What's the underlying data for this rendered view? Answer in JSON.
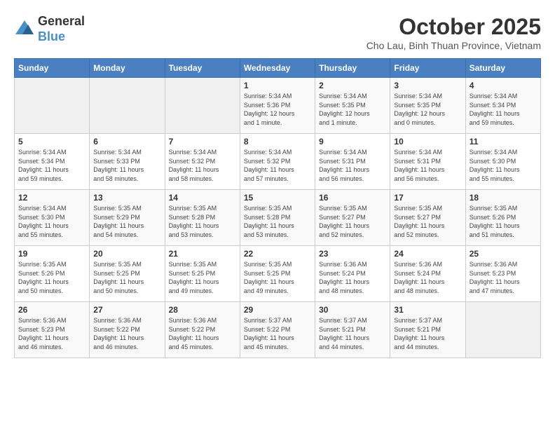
{
  "logo": {
    "general": "General",
    "blue": "Blue"
  },
  "title": "October 2025",
  "subtitle": "Cho Lau, Binh Thuan Province, Vietnam",
  "days_of_week": [
    "Sunday",
    "Monday",
    "Tuesday",
    "Wednesday",
    "Thursday",
    "Friday",
    "Saturday"
  ],
  "weeks": [
    [
      {
        "day": "",
        "info": ""
      },
      {
        "day": "",
        "info": ""
      },
      {
        "day": "",
        "info": ""
      },
      {
        "day": "1",
        "info": "Sunrise: 5:34 AM\nSunset: 5:36 PM\nDaylight: 12 hours\nand 1 minute."
      },
      {
        "day": "2",
        "info": "Sunrise: 5:34 AM\nSunset: 5:35 PM\nDaylight: 12 hours\nand 1 minute."
      },
      {
        "day": "3",
        "info": "Sunrise: 5:34 AM\nSunset: 5:35 PM\nDaylight: 12 hours\nand 0 minutes."
      },
      {
        "day": "4",
        "info": "Sunrise: 5:34 AM\nSunset: 5:34 PM\nDaylight: 11 hours\nand 59 minutes."
      }
    ],
    [
      {
        "day": "5",
        "info": "Sunrise: 5:34 AM\nSunset: 5:34 PM\nDaylight: 11 hours\nand 59 minutes."
      },
      {
        "day": "6",
        "info": "Sunrise: 5:34 AM\nSunset: 5:33 PM\nDaylight: 11 hours\nand 58 minutes."
      },
      {
        "day": "7",
        "info": "Sunrise: 5:34 AM\nSunset: 5:32 PM\nDaylight: 11 hours\nand 58 minutes."
      },
      {
        "day": "8",
        "info": "Sunrise: 5:34 AM\nSunset: 5:32 PM\nDaylight: 11 hours\nand 57 minutes."
      },
      {
        "day": "9",
        "info": "Sunrise: 5:34 AM\nSunset: 5:31 PM\nDaylight: 11 hours\nand 56 minutes."
      },
      {
        "day": "10",
        "info": "Sunrise: 5:34 AM\nSunset: 5:31 PM\nDaylight: 11 hours\nand 56 minutes."
      },
      {
        "day": "11",
        "info": "Sunrise: 5:34 AM\nSunset: 5:30 PM\nDaylight: 11 hours\nand 55 minutes."
      }
    ],
    [
      {
        "day": "12",
        "info": "Sunrise: 5:34 AM\nSunset: 5:30 PM\nDaylight: 11 hours\nand 55 minutes."
      },
      {
        "day": "13",
        "info": "Sunrise: 5:35 AM\nSunset: 5:29 PM\nDaylight: 11 hours\nand 54 minutes."
      },
      {
        "day": "14",
        "info": "Sunrise: 5:35 AM\nSunset: 5:28 PM\nDaylight: 11 hours\nand 53 minutes."
      },
      {
        "day": "15",
        "info": "Sunrise: 5:35 AM\nSunset: 5:28 PM\nDaylight: 11 hours\nand 53 minutes."
      },
      {
        "day": "16",
        "info": "Sunrise: 5:35 AM\nSunset: 5:27 PM\nDaylight: 11 hours\nand 52 minutes."
      },
      {
        "day": "17",
        "info": "Sunrise: 5:35 AM\nSunset: 5:27 PM\nDaylight: 11 hours\nand 52 minutes."
      },
      {
        "day": "18",
        "info": "Sunrise: 5:35 AM\nSunset: 5:26 PM\nDaylight: 11 hours\nand 51 minutes."
      }
    ],
    [
      {
        "day": "19",
        "info": "Sunrise: 5:35 AM\nSunset: 5:26 PM\nDaylight: 11 hours\nand 50 minutes."
      },
      {
        "day": "20",
        "info": "Sunrise: 5:35 AM\nSunset: 5:25 PM\nDaylight: 11 hours\nand 50 minutes."
      },
      {
        "day": "21",
        "info": "Sunrise: 5:35 AM\nSunset: 5:25 PM\nDaylight: 11 hours\nand 49 minutes."
      },
      {
        "day": "22",
        "info": "Sunrise: 5:35 AM\nSunset: 5:25 PM\nDaylight: 11 hours\nand 49 minutes."
      },
      {
        "day": "23",
        "info": "Sunrise: 5:36 AM\nSunset: 5:24 PM\nDaylight: 11 hours\nand 48 minutes."
      },
      {
        "day": "24",
        "info": "Sunrise: 5:36 AM\nSunset: 5:24 PM\nDaylight: 11 hours\nand 48 minutes."
      },
      {
        "day": "25",
        "info": "Sunrise: 5:36 AM\nSunset: 5:23 PM\nDaylight: 11 hours\nand 47 minutes."
      }
    ],
    [
      {
        "day": "26",
        "info": "Sunrise: 5:36 AM\nSunset: 5:23 PM\nDaylight: 11 hours\nand 46 minutes."
      },
      {
        "day": "27",
        "info": "Sunrise: 5:36 AM\nSunset: 5:22 PM\nDaylight: 11 hours\nand 46 minutes."
      },
      {
        "day": "28",
        "info": "Sunrise: 5:36 AM\nSunset: 5:22 PM\nDaylight: 11 hours\nand 45 minutes."
      },
      {
        "day": "29",
        "info": "Sunrise: 5:37 AM\nSunset: 5:22 PM\nDaylight: 11 hours\nand 45 minutes."
      },
      {
        "day": "30",
        "info": "Sunrise: 5:37 AM\nSunset: 5:21 PM\nDaylight: 11 hours\nand 44 minutes."
      },
      {
        "day": "31",
        "info": "Sunrise: 5:37 AM\nSunset: 5:21 PM\nDaylight: 11 hours\nand 44 minutes."
      },
      {
        "day": "",
        "info": ""
      }
    ]
  ]
}
